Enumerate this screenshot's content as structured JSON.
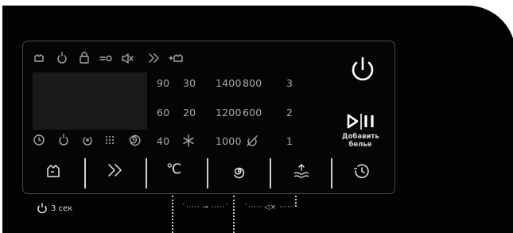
{
  "temps": [
    "90",
    "30",
    "60",
    "20",
    "40"
  ],
  "spins": [
    "1400",
    "800",
    "1200",
    "600",
    "1000"
  ],
  "rinses": [
    "3",
    "2",
    "1"
  ],
  "play_pause": {
    "add_laundry_label": "Добавить\nбелье"
  },
  "buttons": {
    "temperature_label": "℃"
  },
  "hold_hint": {
    "label": "3 сек"
  },
  "combo_hints": {
    "lock_combo": "`····· ⊸ ·····´",
    "mute_combo": "`····· ◁× ·····´"
  },
  "colors": {
    "background": "#030303",
    "panel_border": "#4a4a4a",
    "display": "#1a1a1a",
    "text": "#aaaaaa"
  }
}
